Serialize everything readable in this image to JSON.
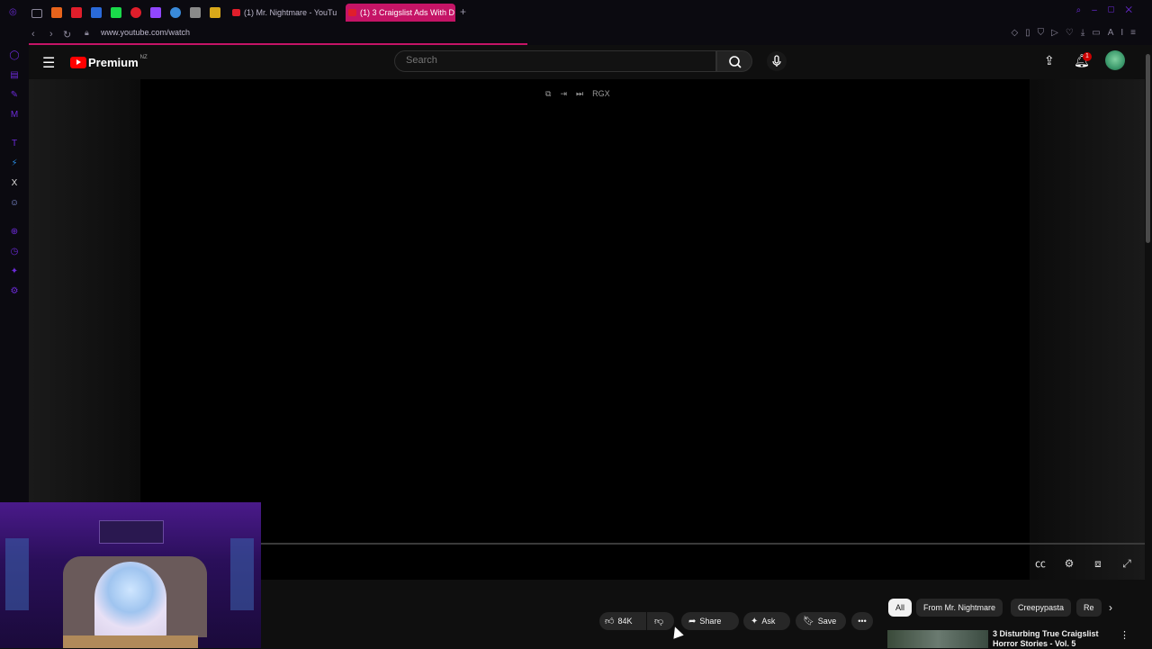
{
  "browser": {
    "tabs": [
      {
        "label": "(1) Mr. Nightmare - YouTu",
        "active": false
      },
      {
        "label": "(1) 3 Craigslist Ads With D",
        "active": true
      }
    ],
    "new_tab_icon": "plus-icon",
    "url": "www.youtube.com/watch",
    "accent": "#c51466",
    "sidebar_accent": "#6c2bd9",
    "ai_label": "AI"
  },
  "youtube": {
    "logo_text": "Premium",
    "country_code": "NZ",
    "search_placeholder": "Search",
    "notifications_count": "1",
    "video_tool_label": "RGX"
  },
  "actions": {
    "like_count": "84K",
    "share_label": "Share",
    "ask_label": "Ask",
    "save_label": "Save"
  },
  "chips": [
    "All",
    "From Mr. Nightmare",
    "Creepypasta",
    "Re"
  ],
  "recommendation": {
    "title": "3 Disturbing True Craigslist Horror Stories - Vol. 5"
  }
}
